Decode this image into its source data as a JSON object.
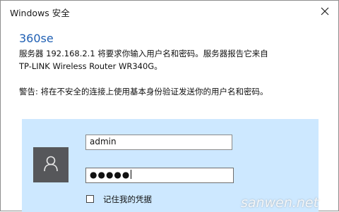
{
  "window": {
    "title": "Windows 安全",
    "close_icon": "close-icon"
  },
  "dialog": {
    "app_name": "360se",
    "message_line1": "服务器 192.168.2.1 将要求你输入用户名和密码。服务器报告它来自",
    "message_line2": "TP-LINK Wireless Router WR340G。",
    "warning": "警告: 将在不安全的连接上使用基本身份验证发送你的用户名和密码。"
  },
  "credentials": {
    "avatar_icon": "user-icon",
    "username_value": "admin",
    "password_masked": "●●●●●",
    "remember_checked": false,
    "remember_label": "记住我的凭据"
  },
  "watermark": "sanwen.net",
  "colors": {
    "app_name": "#1f5fb3",
    "panel_bg": "#cde8ff",
    "avatar_bg": "#56575a"
  }
}
